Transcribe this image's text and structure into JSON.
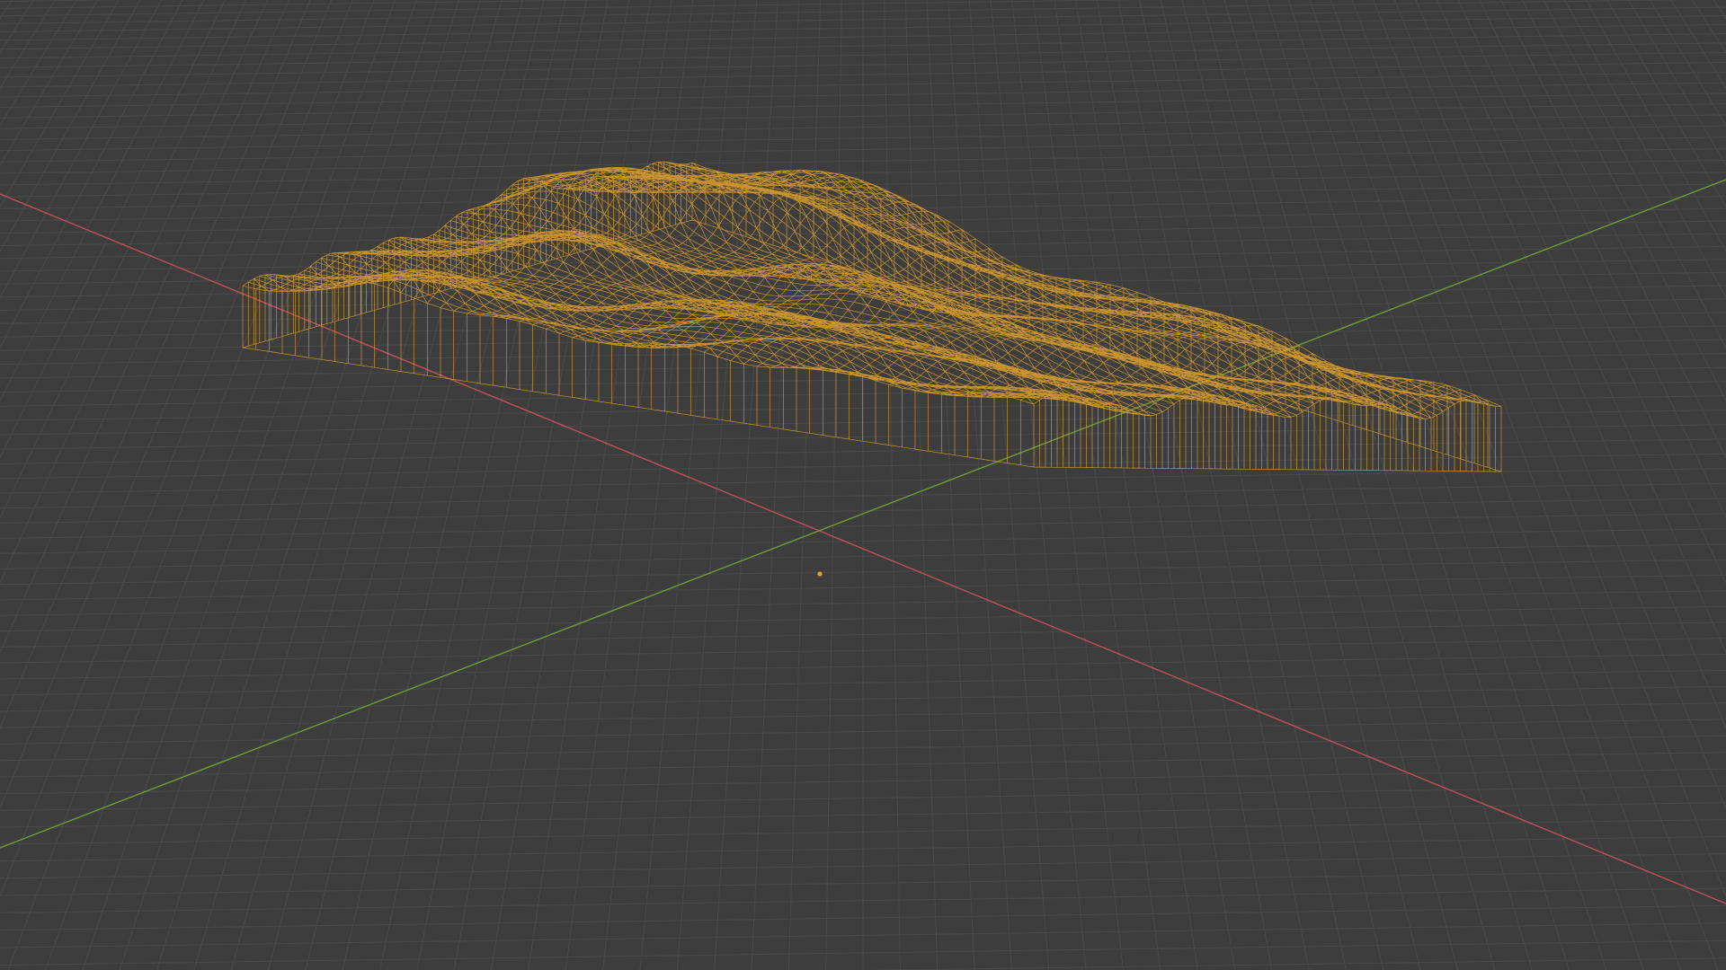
{
  "viewport": {
    "background_color": "#3d3d3d",
    "grid_color": "#4a4a4a",
    "x_axis_color": "#c24f5a",
    "y_axis_color": "#6f9b3a",
    "wireframe_color": "#e3a22a",
    "origin_dot_color": "#e3a22a"
  },
  "scene": {
    "view_mode": "wireframe",
    "object": "terrain-mesh",
    "object_selected": true
  }
}
